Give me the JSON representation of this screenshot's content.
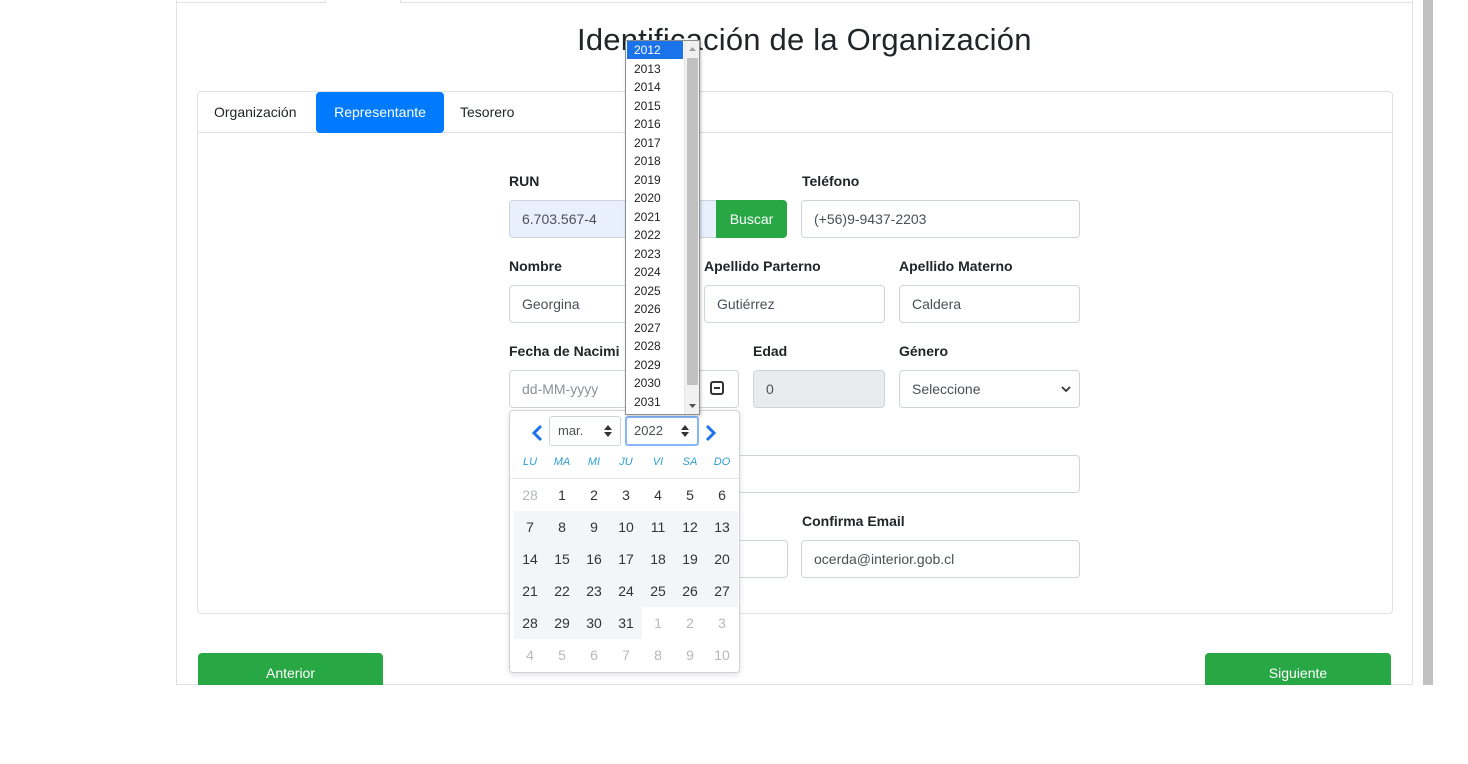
{
  "title": "Identificación de la Organización",
  "tabs": [
    {
      "label": "Organización"
    },
    {
      "label": "Representante"
    },
    {
      "label": "Tesorero"
    }
  ],
  "form": {
    "run": {
      "label": "RUN",
      "value": "6.703.567-4",
      "button": "Buscar"
    },
    "telefono": {
      "label": "Teléfono",
      "value": "(+56)9-9437-2203"
    },
    "nombre": {
      "label": "Nombre",
      "value": "Georgina"
    },
    "apellido_paterno": {
      "label": "Apellido Parterno",
      "value": "Gutiérrez"
    },
    "apellido_materno": {
      "label": "Apellido Materno",
      "value": "Caldera"
    },
    "fecha_nacimiento": {
      "label": "Fecha de Nacimi",
      "placeholder": "dd-MM-yyyy"
    },
    "edad": {
      "label": "Edad",
      "value": "0"
    },
    "genero": {
      "label": "Género",
      "value": "Seleccione"
    },
    "confirma_email": {
      "label": "Confirma Email",
      "value": "ocerda@interior.gob.cl"
    }
  },
  "buttons": {
    "anterior": "Anterior",
    "siguiente": "Siguiente"
  },
  "datepicker": {
    "month": "mar.",
    "year": "2022",
    "weekdays": [
      "LU",
      "MA",
      "MI",
      "JU",
      "VI",
      "SA",
      "DO"
    ],
    "weeks": [
      [
        {
          "d": "28",
          "m": true
        },
        {
          "d": "1"
        },
        {
          "d": "2"
        },
        {
          "d": "3"
        },
        {
          "d": "4"
        },
        {
          "d": "5"
        },
        {
          "d": "6"
        }
      ],
      [
        {
          "d": "7"
        },
        {
          "d": "8"
        },
        {
          "d": "9"
        },
        {
          "d": "10"
        },
        {
          "d": "11"
        },
        {
          "d": "12"
        },
        {
          "d": "13"
        }
      ],
      [
        {
          "d": "14"
        },
        {
          "d": "15"
        },
        {
          "d": "16"
        },
        {
          "d": "17"
        },
        {
          "d": "18"
        },
        {
          "d": "19"
        },
        {
          "d": "20"
        }
      ],
      [
        {
          "d": "21"
        },
        {
          "d": "22"
        },
        {
          "d": "23"
        },
        {
          "d": "24"
        },
        {
          "d": "25"
        },
        {
          "d": "26"
        },
        {
          "d": "27"
        }
      ],
      [
        {
          "d": "28"
        },
        {
          "d": "29"
        },
        {
          "d": "30"
        },
        {
          "d": "31"
        },
        {
          "d": "1",
          "m": true
        },
        {
          "d": "2",
          "m": true
        },
        {
          "d": "3",
          "m": true
        }
      ],
      [
        {
          "d": "4",
          "m": true
        },
        {
          "d": "5",
          "m": true
        },
        {
          "d": "6",
          "m": true
        },
        {
          "d": "7",
          "m": true
        },
        {
          "d": "8",
          "m": true
        },
        {
          "d": "9",
          "m": true
        },
        {
          "d": "10",
          "m": true
        }
      ]
    ]
  },
  "year_options": [
    "2012",
    "2013",
    "2014",
    "2015",
    "2016",
    "2017",
    "2018",
    "2019",
    "2020",
    "2021",
    "2022",
    "2023",
    "2024",
    "2025",
    "2026",
    "2027",
    "2028",
    "2029",
    "2030",
    "2031"
  ],
  "year_selected": "2012",
  "colors": {
    "primary": "#007bff",
    "success": "#28a745",
    "datepicker_accent": "#2f9fd4",
    "list_highlight": "#1a73e8"
  }
}
